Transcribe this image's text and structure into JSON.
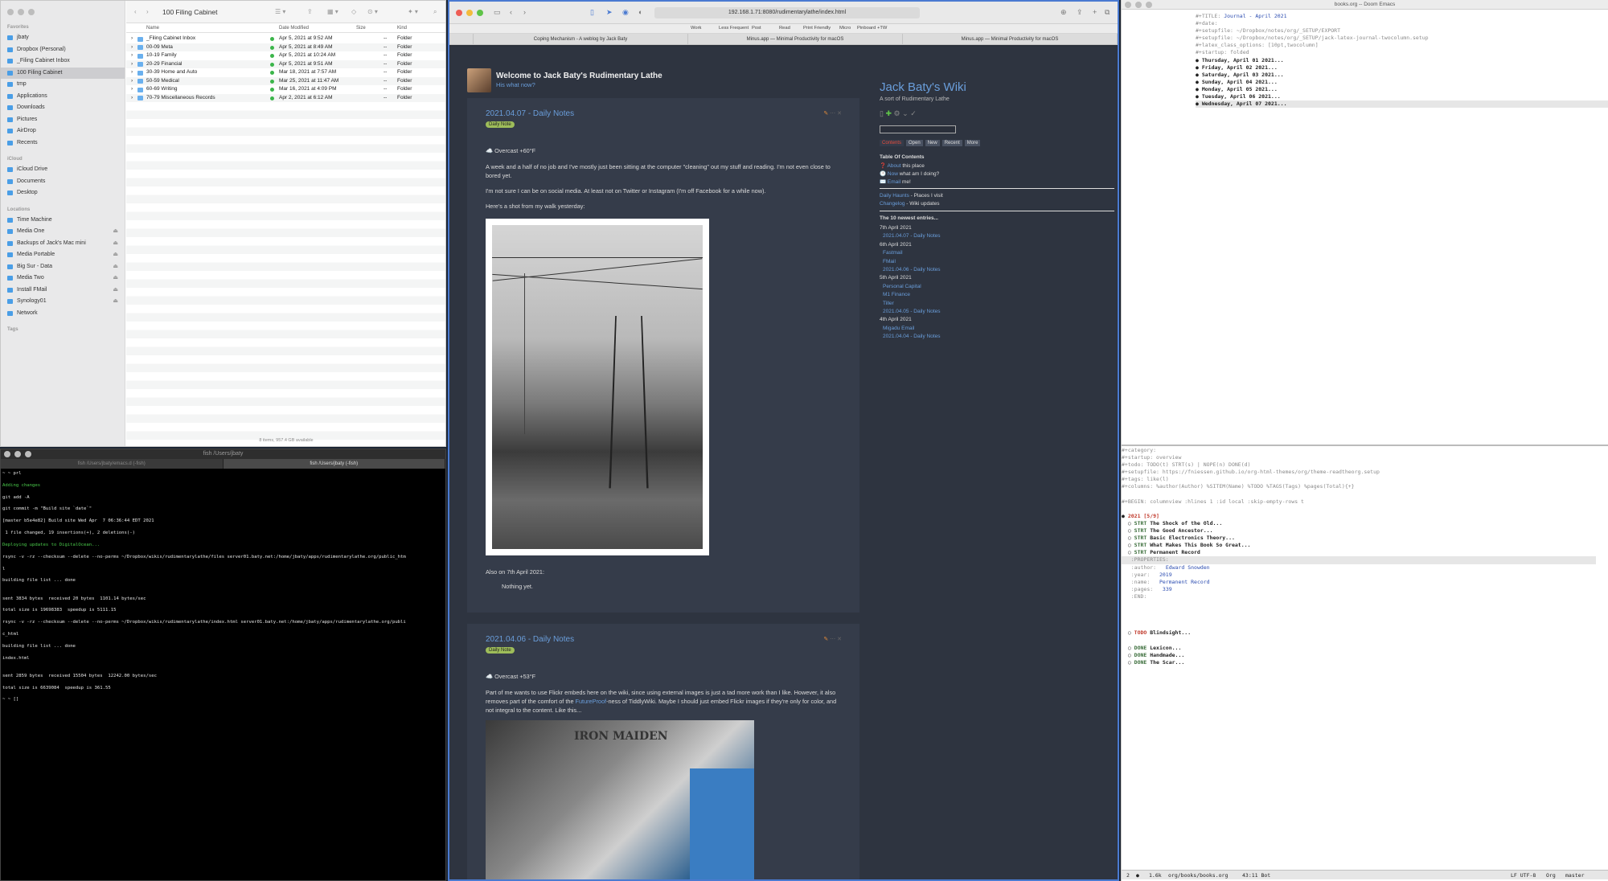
{
  "finder": {
    "title": "100 Filing Cabinet",
    "sidebar": {
      "favorites_label": "Favorites",
      "favorites": [
        "jbaty",
        "Dropbox (Personal)",
        "_Filing Cabinet Inbox",
        "100 Filing Cabinet",
        "tmp",
        "Applications",
        "Downloads",
        "Pictures",
        "AirDrop",
        "Recents"
      ],
      "icloud_label": "iCloud",
      "icloud": [
        "iCloud Drive",
        "Documents",
        "Desktop"
      ],
      "locations_label": "Locations",
      "locations": [
        "Time Machine",
        "Media One",
        "Backups of Jack's Mac mini",
        "Media Portable",
        "Big Sur - Data",
        "Media Two",
        "Install FMail",
        "Synology01",
        "Network"
      ],
      "tags_label": "Tags"
    },
    "columns": {
      "name": "Name",
      "date": "Date Modified",
      "size": "Size",
      "kind": "Kind"
    },
    "rows": [
      {
        "name": "_Filing Cabinet Inbox",
        "date": "Apr 5, 2021 at 9:52 AM",
        "size": "--",
        "kind": "Folder"
      },
      {
        "name": "00-09 Meta",
        "date": "Apr 5, 2021 at 8:49 AM",
        "size": "--",
        "kind": "Folder"
      },
      {
        "name": "10-19 Family",
        "date": "Apr 5, 2021 at 10:24 AM",
        "size": "--",
        "kind": "Folder"
      },
      {
        "name": "20-29 Financial",
        "date": "Apr 5, 2021 at 9:51 AM",
        "size": "--",
        "kind": "Folder"
      },
      {
        "name": "30-39 Home and Auto",
        "date": "Mar 18, 2021 at 7:57 AM",
        "size": "--",
        "kind": "Folder"
      },
      {
        "name": "50-59 Medical",
        "date": "Mar 25, 2021 at 11:47 AM",
        "size": "--",
        "kind": "Folder"
      },
      {
        "name": "60-69 Writing",
        "date": "Mar 16, 2021 at 4:09 PM",
        "size": "--",
        "kind": "Folder"
      },
      {
        "name": "70-79 Miscellaneous Records",
        "date": "Apr 2, 2021 at 6:12 AM",
        "size": "--",
        "kind": "Folder"
      }
    ],
    "status": "8 items, 957.4 GB available"
  },
  "terminal": {
    "title": "fish /Users/jbaty",
    "tabs": [
      "fish /Users/jbaty/emacs.d (-fish)",
      "fish /Users/jbaty (-fish)"
    ],
    "lines": [
      "~ ~ prl",
      "Adding changes",
      "git add -A",
      "git commit -m \"Build site `date`\"",
      "[master b5e4e82] Build site Wed Apr  7 06:36:44 EDT 2021",
      " 1 file changed, 19 insertions(+), 2 deletions(-)",
      "Deploying updates to DigitalOcean...",
      "rsync -v -rz --checksum --delete --no-perms ~/Dropbox/wikis/rudimentarylathe/files server01.baty.net:/home/jbaty/apps/rudimentarylathe.org/public_htm",
      "l",
      "building file list ... done",
      "",
      "sent 3834 bytes  received 20 bytes  1101.14 bytes/sec",
      "total size is 19698383  speedup is 5111.15",
      "rsync -v -rz --checksum --delete --no-perms ~/Dropbox/wikis/rudimentarylathe/index.html server01.baty.net:/home/jbaty/apps/rudimentarylathe.org/publi",
      "c_html",
      "building file list ... done",
      "index.html",
      "",
      "sent 2859 bytes  received 15504 bytes  12242.00 bytes/sec",
      "total size is 6639084  speedup is 361.55",
      "~ ~ []"
    ]
  },
  "safari": {
    "url": "192.168.1.71:8080/rudimentarylathe/index.html",
    "favorites": [
      "Work",
      "Less Frequent",
      "Post",
      "Read",
      "Print Friendly",
      "Micro",
      "Pinboard",
      "+TW"
    ],
    "tabs": [
      "Coping Mechanism - A weblog by Jack Baty",
      "Minus.app — Minimal Productivity for macOS",
      "Minus.app — Minimal Productivity for macOS"
    ],
    "site_title": "Welcome to Jack Baty's Rudimentary Lathe",
    "site_subtitle": "His what now?",
    "tiddler1": {
      "title": "2021.04.07 - Daily Notes",
      "tag": "Daily Note",
      "weather": "☁️ Overcast +60°F",
      "p1": "A week and a half of no job and I've mostly just been sitting at the computer \"cleaning\" out my stuff and reading. I'm not even close to bored yet.",
      "p2": "I'm not sure I can be on social media. At least not on Twitter or Instagram (I'm off Facebook for a while now).",
      "p3": "Here's a shot from my walk yesterday:",
      "also": "Also on 7th April 2021:",
      "nothing": "Nothing yet."
    },
    "tiddler2": {
      "title": "2021.04.06 - Daily Notes",
      "tag": "Daily Note",
      "weather": "☁️ Overcast +53°F",
      "p1a": "Part of me wants to use Flickr embeds here on the wiki, since using external images is just a tad more work than I like. However, it also removes part of the comfort of the ",
      "link": "FutureProof",
      "p1b": "-ness of TiddlyWiki. Maybe I should just embed Flickr images if they're only for color, and not integral to the content. Like this...",
      "image_text": "IRON MAIDEN"
    },
    "wiki": {
      "title": "Jack Baty's Wiki",
      "subtitle": "A sort of Rudimentary Lathe",
      "tabs": [
        "Contents",
        "Open",
        "New",
        "Recent",
        "More"
      ],
      "toc_label": "Table Of Contents",
      "toc": [
        {
          "icon": "❓",
          "link": "About",
          "text": "this place"
        },
        {
          "icon": "🕐",
          "link": "Now",
          "text": "what am I doing?"
        },
        {
          "icon": "✉️",
          "link": "Email",
          "text": "me!"
        }
      ],
      "links": [
        {
          "link": "Daily Haunts",
          "text": " - Places I visit"
        },
        {
          "link": "Changelog",
          "text": " - Wiki updates"
        }
      ],
      "newest_label": "The 10 newest entries...",
      "entries": [
        {
          "date": "7th April 2021",
          "items": [
            "2021.04.07 - Daily Notes"
          ]
        },
        {
          "date": "6th April 2021",
          "items": [
            "Fastmail",
            "FMail",
            "2021.04.06 - Daily Notes"
          ]
        },
        {
          "date": "5th April 2021",
          "items": [
            "Personal Capital",
            "M1 Finance",
            "Tiller",
            "2021.04.05 - Daily Notes"
          ]
        },
        {
          "date": "4th April 2021",
          "items": [
            "Migadu Email",
            "2021.04.04 - Daily Notes"
          ]
        }
      ]
    }
  },
  "emacs": {
    "title": "books.org -- Doom Emacs",
    "top_lines": [
      {
        "k": "#+TITLE: ",
        "v": "Journal - April 2021"
      },
      {
        "k": "#+date:",
        "v": ""
      },
      {
        "k": "#+setupfile: ~/Dropbox/notes/org/_SETUP/EXPORT",
        "v": ""
      },
      {
        "k": "#+setupfile: ~/Dropbox/notes/org/_SETUP/jack-latex-journal-twocolumn.setup",
        "v": ""
      },
      {
        "k": "#+latex_class_options: [10pt,twocolumn]",
        "v": ""
      },
      {
        "k": "#+startup: folded",
        "v": ""
      }
    ],
    "journal_heads": [
      "Thursday, April 01 2021...",
      "Friday, April 02 2021...",
      "Saturday, April 03 2021...",
      "Sunday, April 04 2021...",
      "Monday, April 05 2021...",
      "Tuesday, April 06 2021...",
      "Wednesday, April 07 2021..."
    ],
    "bottom_lines": [
      "#+category:",
      "#+startup: overview",
      "#+todo: TODO(t) STRT(s) | NOPE(n) DONE(d)",
      "#+setupfile: https://fniessen.github.io/org-html-themes/org/theme-readtheorg.setup",
      "#+tags: like(l)",
      "#+columns: %author(Author) %SITEM(Name) %TODO %TAGS(Tags) %pages(Total){+}",
      "",
      "#+BEGIN: columnview :hlines 1 :id local :skip-empty-rows t"
    ],
    "year_head": "2021 [5/9]",
    "books": [
      {
        "state": "STRT",
        "title": "The Shock of the Old..."
      },
      {
        "state": "STRT",
        "title": "The Good Ancestor..."
      },
      {
        "state": "STRT",
        "title": "Basic Electronics Theory..."
      },
      {
        "state": "STRT",
        "title": "What Makes This Book So Great..."
      },
      {
        "state": "STRT",
        "title": "Permanent Record"
      }
    ],
    "properties": [
      {
        "k": ":PROPERTIES:",
        "v": ""
      },
      {
        "k": ":author:",
        "v": "Edward Snowden"
      },
      {
        "k": ":year:",
        "v": "2019"
      },
      {
        "k": ":name:",
        "v": "Permanent Record"
      },
      {
        "k": ":pages:",
        "v": "339"
      },
      {
        "k": ":END:",
        "v": ""
      }
    ],
    "more_books": [
      {
        "state": "TODO",
        "title": "Blindsight..."
      },
      {
        "state": "DONE",
        "title": "Lexicon..."
      },
      {
        "state": "DONE",
        "title": "Handmade..."
      },
      {
        "state": "DONE",
        "title": "The Scar..."
      }
    ],
    "modeline": {
      "num": "2",
      "size": "1.6k",
      "file": "org/books/books.org",
      "pos": "43:11 Bot",
      "enc": "LF UTF-8",
      "mode": "Org",
      "branch": "master"
    }
  }
}
